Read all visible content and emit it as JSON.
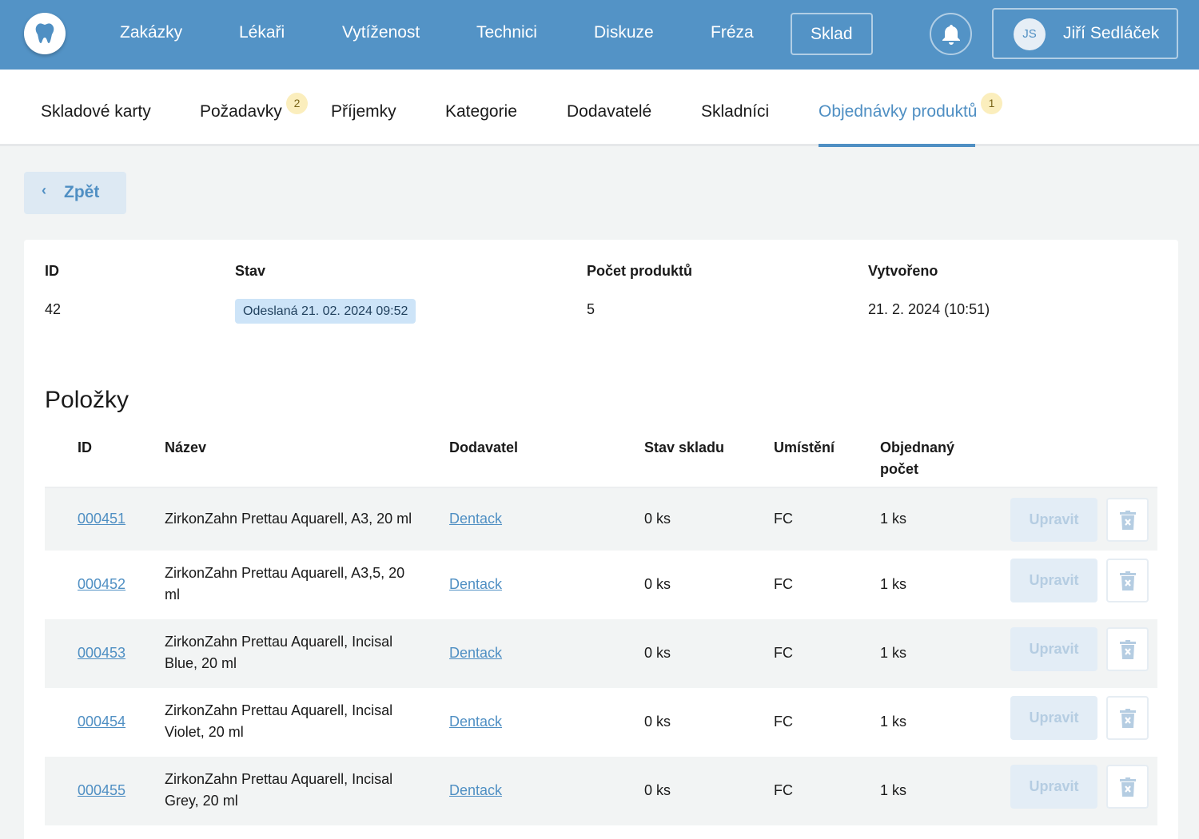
{
  "colors": {
    "brand": "#5393c6",
    "accent": "#4f8fc3",
    "badge": "#fbeebd",
    "status": "#cde4f8"
  },
  "topnav": {
    "logo_icon": "tooth-icon",
    "items": [
      {
        "label": "Zakázky"
      },
      {
        "label": "Lékaři"
      },
      {
        "label": "Vytíženost"
      },
      {
        "label": "Technici"
      },
      {
        "label": "Diskuze"
      },
      {
        "label": "Fréza"
      },
      {
        "label": "Sklad",
        "active": true
      }
    ],
    "notifications_icon": "bell-icon",
    "user": {
      "initials": "JS",
      "name": "Jiří Sedláček"
    }
  },
  "tabs": [
    {
      "label": "Skladové karty"
    },
    {
      "label": "Požadavky",
      "badge": "2"
    },
    {
      "label": "Příjemky"
    },
    {
      "label": "Kategorie"
    },
    {
      "label": "Dodavatelé"
    },
    {
      "label": "Skladníci"
    },
    {
      "label": "Objednávky produktů",
      "badge": "1",
      "active": true
    }
  ],
  "back": {
    "label": "Zpět",
    "icon": "chevron-left-icon"
  },
  "order": {
    "labels": {
      "id": "ID",
      "status": "Stav",
      "count": "Počet produktů",
      "created": "Vytvořeno"
    },
    "id": "42",
    "status": "Odeslaná 21. 02. 2024 09:52",
    "count": "5",
    "created": "21. 2. 2024 (10:51)"
  },
  "items": {
    "title": "Položky",
    "columns": {
      "id": "ID",
      "name": "Název",
      "supplier": "Dodavatel",
      "stock": "Stav skladu",
      "location": "Umístění",
      "ordered_1": "Objednaný",
      "ordered_2": "počet"
    },
    "edit_label": "Upravit",
    "delete_icon": "trash-icon",
    "rows": [
      {
        "id": "000451",
        "name_1": "ZirkonZahn Prettau Aquarell, A3, 20 ml",
        "name_2": "",
        "supplier": "Dentack",
        "stock": "0 ks",
        "location": "FC",
        "ordered": "1 ks"
      },
      {
        "id": "000452",
        "name_1": "ZirkonZahn Prettau Aquarell, A3,5, 20",
        "name_2": "ml",
        "supplier": "Dentack",
        "stock": "0 ks",
        "location": "FC",
        "ordered": "1 ks"
      },
      {
        "id": "000453",
        "name_1": "ZirkonZahn Prettau Aquarell, Incisal",
        "name_2": "Blue, 20 ml",
        "supplier": "Dentack",
        "stock": "0 ks",
        "location": "FC",
        "ordered": "1 ks"
      },
      {
        "id": "000454",
        "name_1": "ZirkonZahn Prettau Aquarell, Incisal",
        "name_2": "Violet, 20 ml",
        "supplier": "Dentack",
        "stock": "0 ks",
        "location": "FC",
        "ordered": "1 ks"
      },
      {
        "id": "000455",
        "name_1": "ZirkonZahn Prettau Aquarell, Incisal",
        "name_2": "Grey, 20 ml",
        "supplier": "Dentack",
        "stock": "0 ks",
        "location": "FC",
        "ordered": "1 ks"
      }
    ]
  }
}
